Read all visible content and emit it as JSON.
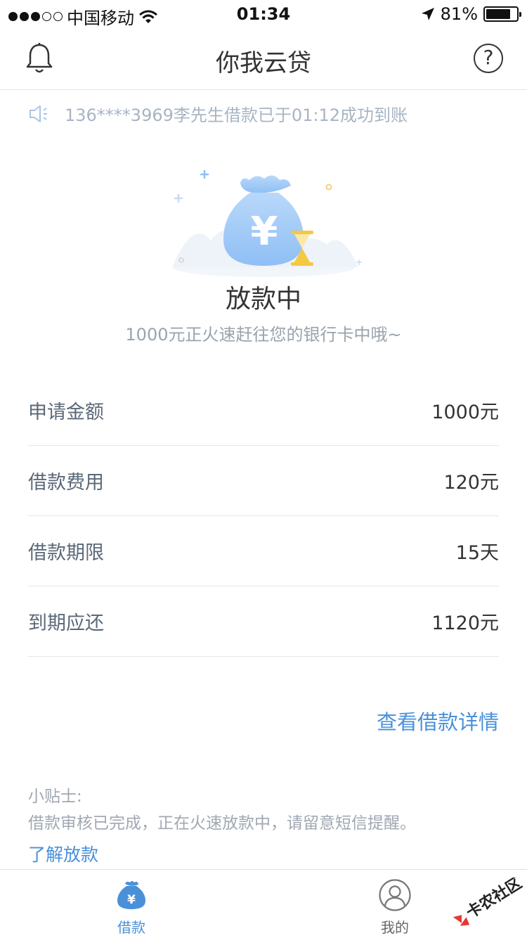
{
  "status_bar": {
    "carrier": "中国移动",
    "time": "01:34",
    "battery": "81%",
    "battery_level": 0.81
  },
  "nav": {
    "title": "你我云贷",
    "help_glyph": "?"
  },
  "notice": {
    "text": "136****3969李先生借款已于01:12成功到账"
  },
  "status": {
    "title": "放款中",
    "subtitle": "1000元正火速赶往您的银行卡中哦~",
    "currency_symbol": "¥"
  },
  "info": [
    {
      "label": "申请金额",
      "value": "1000元"
    },
    {
      "label": "借款费用",
      "value": "120元"
    },
    {
      "label": "借款期限",
      "value": "15天"
    },
    {
      "label": "到期应还",
      "value": "1120元"
    }
  ],
  "detail_link": "查看借款详情",
  "tips": {
    "title": "小贴士:",
    "body": "借款审核已完成，正在火速放款中，请留意短信提醒。",
    "link": "了解放款"
  },
  "tabs": [
    {
      "label": "借款",
      "active": true
    },
    {
      "label": "我的",
      "active": false
    }
  ],
  "watermark": "卡农社区",
  "colors": {
    "accent": "#4a90d9",
    "text": "#333333",
    "muted": "#9aa3ad"
  }
}
